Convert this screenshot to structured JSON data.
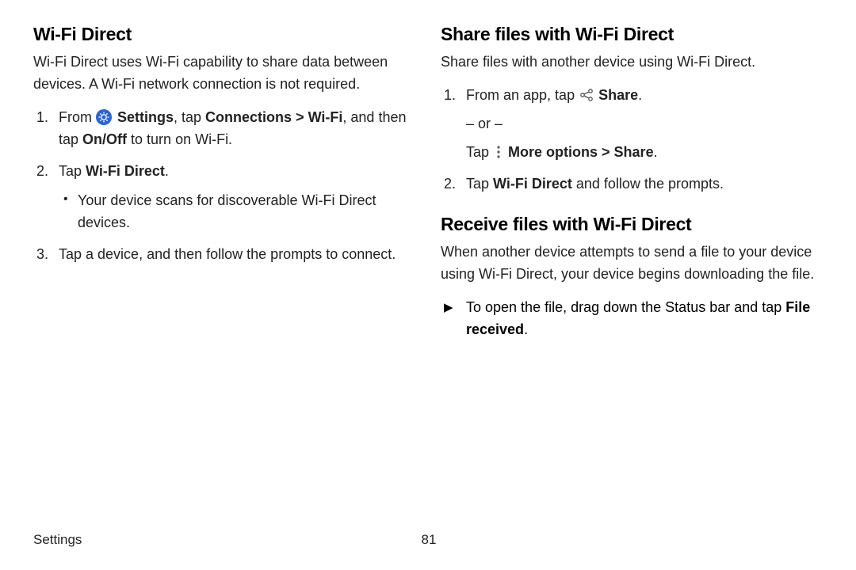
{
  "left": {
    "heading": "Wi-Fi Direct",
    "intro": "Wi-Fi Direct uses Wi-Fi capability to share data between devices. A Wi-Fi network connection is not required.",
    "step1_a": "From ",
    "step1_settings": " Settings",
    "step1_b": ", tap ",
    "step1_connections": "Connections",
    "step1_sep": " > ",
    "step1_wifi": "Wi-Fi",
    "step1_c": ", and then tap ",
    "step1_onoff": "On/Off",
    "step1_d": " to turn on Wi-Fi.",
    "step2_a": "Tap ",
    "step2_wfd": "Wi-Fi Direct",
    "step2_b": ".",
    "step2_sub": "Your device scans for discoverable Wi-Fi Direct devices.",
    "step3": "Tap a device, and then follow the prompts to connect."
  },
  "right": {
    "heading_share": "Share files with Wi-Fi Direct",
    "share_intro": "Share files with another device using Wi-Fi Direct.",
    "s1_a": "From an app, tap ",
    "s1_share": " Share",
    "s1_b": ".",
    "or": "– or –",
    "s1_c": "Tap ",
    "s1_more": " More options",
    "s1_sep": " > ",
    "s1_share2": "Share",
    "s1_d": ".",
    "s2_a": "Tap ",
    "s2_wfd": "Wi-Fi Direct",
    "s2_b": " and follow the prompts.",
    "heading_receive": "Receive files with Wi-Fi Direct",
    "receive_intro": "When another device attempts to send a file to your device using Wi-Fi Direct, your device begins downloading the file.",
    "r1_a": "To open the file, drag down the Status bar and tap ",
    "r1_file": "File received",
    "r1_b": "."
  },
  "footer": {
    "section": "Settings",
    "page": "81"
  },
  "nums": {
    "n1": "1.",
    "n2": "2.",
    "n3": "3."
  }
}
